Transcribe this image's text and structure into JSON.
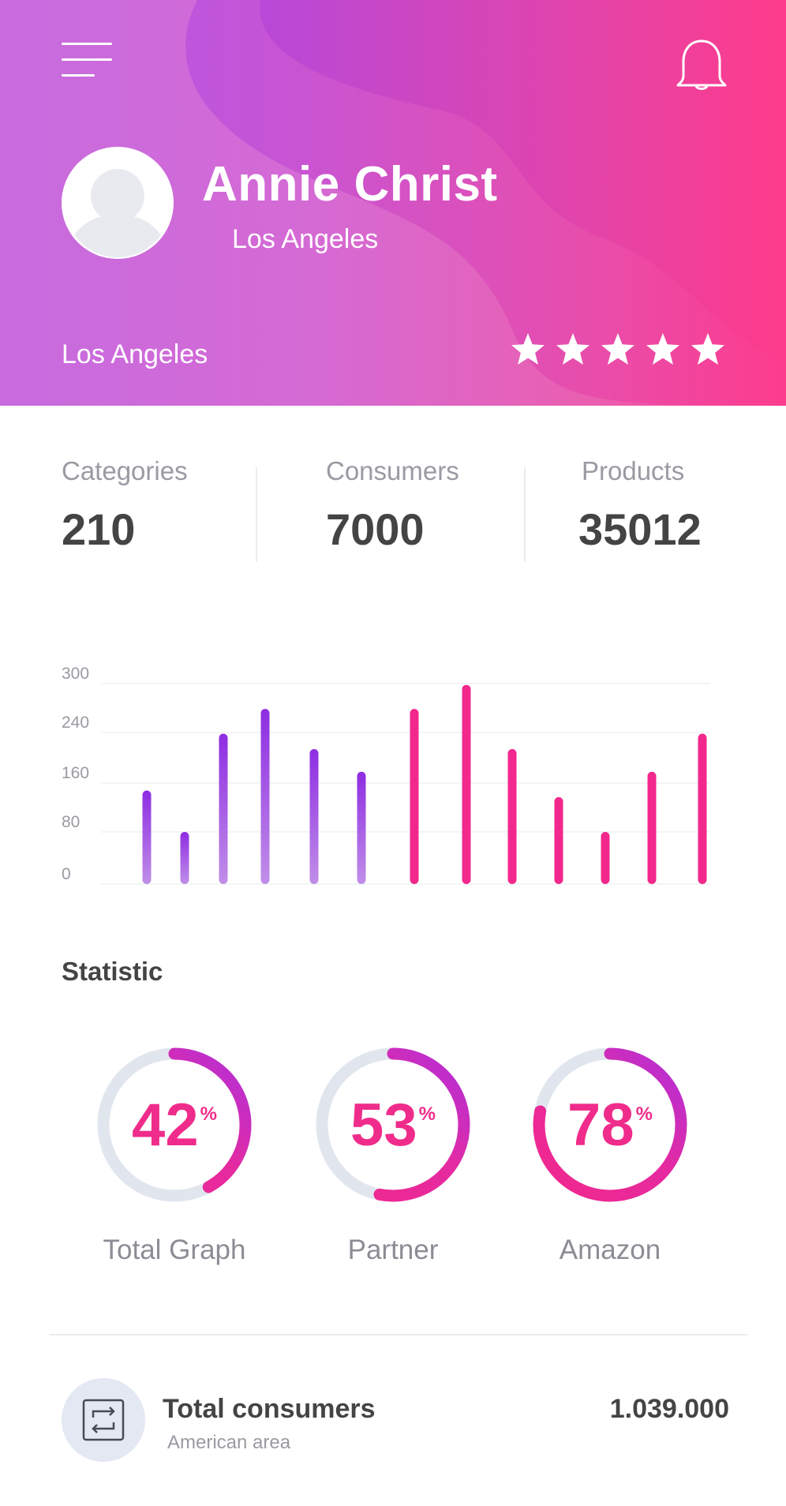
{
  "header": {
    "menu_icon": "hamburger-menu-icon",
    "bell_icon": "bell-icon",
    "user_name": "Annie Christ",
    "user_city": "Los Angeles",
    "location": "Los Angeles",
    "rating": 5,
    "rating_max": 5
  },
  "stats": [
    {
      "label": "Categories",
      "value": "210"
    },
    {
      "label": "Consumers",
      "value": "7000"
    },
    {
      "label": "Products",
      "value": "35012"
    }
  ],
  "chart_data": {
    "type": "bar",
    "ticks": [
      "300",
      "240",
      "160",
      "80",
      "0"
    ],
    "values": [
      140,
      78,
      225,
      262,
      202,
      168,
      262,
      298,
      202,
      130,
      78,
      168,
      225
    ],
    "ylim": [
      0,
      300
    ],
    "colors": {
      "purple": "#8e2de2",
      "pink": "#f2288c"
    }
  },
  "statistic": {
    "title": "Statistic",
    "items": [
      {
        "value": "42",
        "unit": "%",
        "label": "Total Graph",
        "percent": 42
      },
      {
        "value": "53",
        "unit": "%",
        "label": "Partner",
        "percent": 53
      },
      {
        "value": "78",
        "unit": "%",
        "label": "Amazon",
        "percent": 78
      }
    ]
  },
  "footer": {
    "icon": "transfer-icon",
    "title": "Total consumers",
    "subtitle": "American area",
    "value": "1.039.000"
  }
}
